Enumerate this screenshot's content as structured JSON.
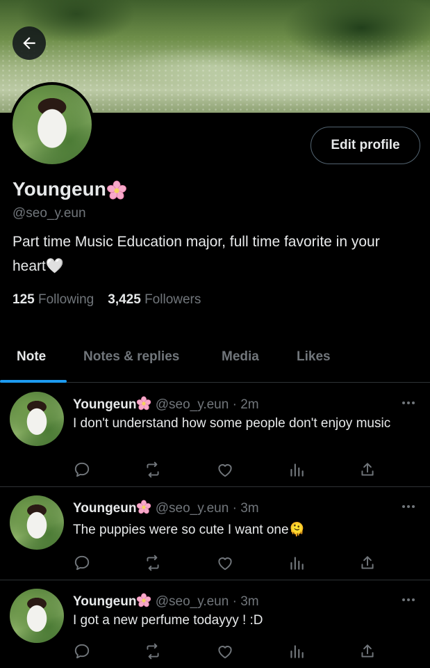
{
  "profile": {
    "display_name": "Youngeun",
    "handle": "@seo_y.eun",
    "bio": "Part time Music Education major, full time favorite in your heart🤍",
    "following_count": "125",
    "following_label": "Following",
    "followers_count": "3,425",
    "followers_label": "Followers",
    "edit_label": "Edit profile"
  },
  "tabs": [
    {
      "label": "Note",
      "active": true
    },
    {
      "label": "Notes & replies",
      "active": false
    },
    {
      "label": "Media",
      "active": false
    },
    {
      "label": "Likes",
      "active": false
    }
  ],
  "tweets": [
    {
      "name": "Youngeun",
      "handle": "@seo_y.eun",
      "time": "2m",
      "sep": "·",
      "text": "I don't understand how some people don't enjoy music"
    },
    {
      "name": "Youngeun",
      "handle": "@seo_y.eun",
      "time": "3m",
      "sep": "·",
      "text": "The puppies were so cute I want one🫠"
    },
    {
      "name": "Youngeun",
      "handle": "@seo_y.eun",
      "time": "3m",
      "sep": "·",
      "text": "I got a new perfume todayyy ! :D"
    }
  ],
  "icons": {
    "back": "arrow-left-icon",
    "reply": "reply-icon",
    "retweet": "retweet-icon",
    "like": "heart-icon",
    "views": "analytics-icon",
    "share": "share-icon",
    "more": "more-icon"
  },
  "colors": {
    "accent": "#1d9bf0",
    "background": "#000000",
    "text": "#e7e9ea",
    "muted": "#71767b",
    "divider": "#2f3336"
  }
}
